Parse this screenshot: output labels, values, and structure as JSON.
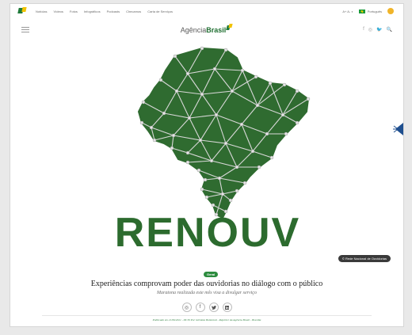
{
  "gov_bar": {
    "links": [
      "Notícias",
      "Vídeos",
      "Fotos",
      "Infográficos",
      "Podcasts",
      "Checamos",
      "Carta de Serviços"
    ],
    "contrast_toggle": "A+ A- ◐",
    "language": "Português"
  },
  "header": {
    "brand_prefix": "Agência",
    "brand_suffix": "Brasil",
    "tools": [
      "f",
      "◎",
      "🐦",
      "🔍"
    ]
  },
  "hero": {
    "word": "RENOUV",
    "credit": "© Rede Nacional de Ouvidorias",
    "colors": {
      "map": "#2f6b30",
      "text": "#2c6b2e",
      "lines": "#d8d8d8"
    }
  },
  "article": {
    "tag": "Geral",
    "title": "Experiências comprovam poder das ouvidorias no diálogo com o público",
    "subtitle": "Maratona realizada este mês visa a divulgar serviço",
    "share_icons": [
      "whatsapp-icon",
      "facebook-icon",
      "twitter-icon",
      "linkedin-icon"
    ],
    "published": "Publicado em 21/06/2021 - 06:30 Por Gilvânia Bottentuit - Repórter da Agência Brasil - Brasília"
  }
}
